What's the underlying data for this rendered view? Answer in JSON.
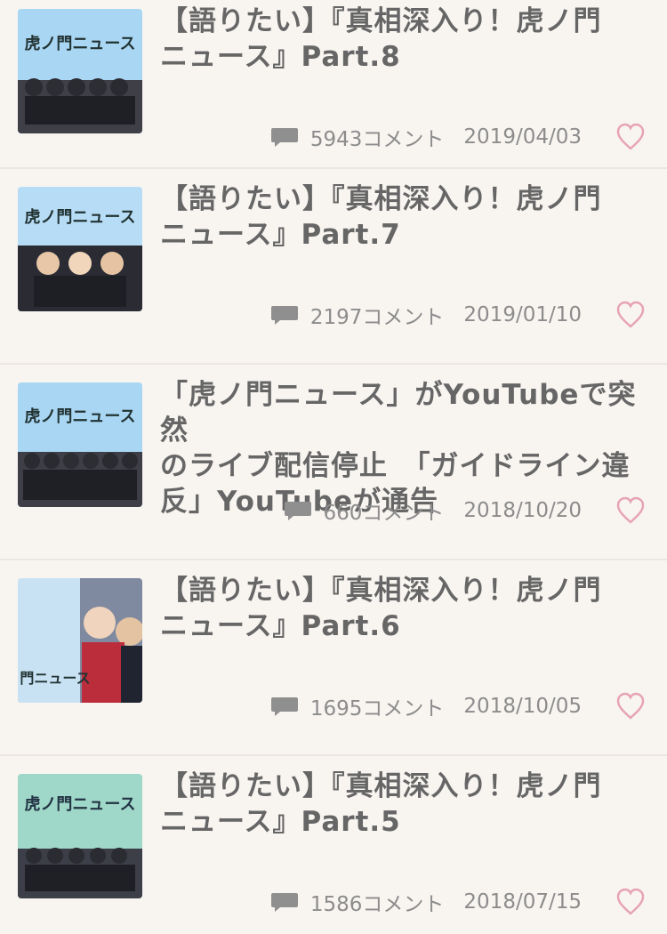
{
  "colors": {
    "background": "#f6f2ee",
    "row_divider": "#ece6e1",
    "title_text": "#666666",
    "meta_text": "#8c8c8c",
    "heart_outline": "#e7a3b5",
    "comment_icon": "#8f8f8f"
  },
  "icons": {
    "comment": "speech-bubble-icon",
    "favorite": "heart-outline-icon"
  },
  "articles": [
    {
      "title_line1": "【語りたい】『真相深入り！虎ノ門",
      "title_line2": "ニュース』Part.8",
      "title_line3": "",
      "comments": "5943コメント",
      "date": "2019/04/03",
      "thumbnail_label": "虎ノ門ニュース"
    },
    {
      "title_line1": "【語りたい】『真相深入り！虎ノ門",
      "title_line2": "ニュース』Part.7",
      "title_line3": "",
      "comments": "2197コメント",
      "date": "2019/01/10",
      "thumbnail_label": "虎ノ門ニュース"
    },
    {
      "title_line1": "「虎ノ門ニュース」がYouTubeで突然",
      "title_line2": "のライブ配信停止　「ガイドライン違",
      "title_line3": "反」YouTubeが通告",
      "comments": "660コメント",
      "date": "2018/10/20",
      "thumbnail_label": "虎ノ門ニュース"
    },
    {
      "title_line1": "【語りたい】『真相深入り！虎ノ門",
      "title_line2": "ニュース』Part.6",
      "title_line3": "",
      "comments": "1695コメント",
      "date": "2018/10/05",
      "thumbnail_label": "ノ門ニュース"
    },
    {
      "title_line1": "【語りたい】『真相深入り！虎ノ門",
      "title_line2": "ニュース』Part.5",
      "title_line3": "",
      "comments": "1586コメント",
      "date": "2018/07/15",
      "thumbnail_label": "虎ノ門ニュース"
    }
  ]
}
